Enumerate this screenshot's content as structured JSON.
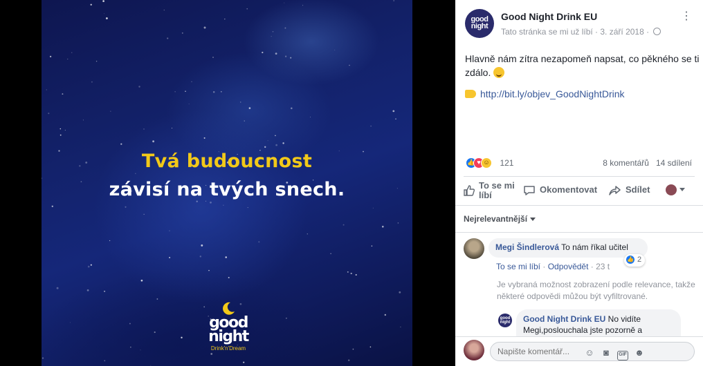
{
  "media": {
    "headline_line1": "Tvá budoucnost",
    "headline_line2": "závisí na tvých snech.",
    "logo_word1": "good",
    "logo_word2": "night",
    "logo_tagline": "Drink'n'Dream",
    "colors": {
      "yellow": "#f2c919",
      "night_blue": "#13226b"
    }
  },
  "post": {
    "page_name": "Good Night Drink EU",
    "avatar_text": "good night",
    "meta": "Tato stránka se mi už líbí · 3. září 2018 ·",
    "text": "Hlavně nám zítra nezapomeň napsat, co pěkného se ti zdálo.",
    "link": "http://bit.ly/objev_GoodNightDrink",
    "reaction_count": "121",
    "comments_count": "8 komentářů",
    "shares_count": "14 sdílení",
    "icons": {
      "more": "more-options-icon",
      "globe": "globe-icon",
      "emoji": "smile-emoji",
      "hand": "pointing-hand-emoji"
    }
  },
  "actions": {
    "like": "To se mi líbí",
    "comment": "Okomentovat",
    "share": "Sdílet"
  },
  "comments": {
    "sort_label": "Nejrelevantnější",
    "items": [
      {
        "author": "Megi Šindlerová",
        "text": "To nám říkal učitel",
        "like_label": "To se mi líbí",
        "reply_label": "Odpovědět",
        "time": "23 t",
        "reaction_count": "2"
      }
    ],
    "filter_note": "Je vybraná možnost zobrazení podle relevance, takže některé odpovědi můžou být vyfiltrované.",
    "reply": {
      "author": "Good Night Drink EU",
      "text": "No vidíte Megi,poslouchala jste pozorně a"
    },
    "composer_placeholder": "Napište komentář..."
  }
}
